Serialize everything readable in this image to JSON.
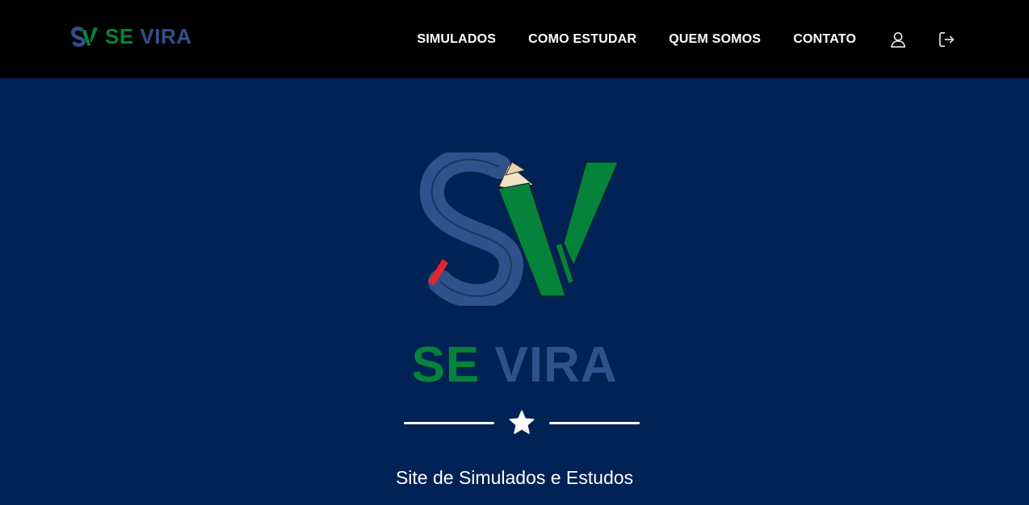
{
  "navbar": {
    "brand": {
      "se": "SE",
      "vira": "VIRA"
    },
    "links": [
      {
        "label": "SIMULADOS"
      },
      {
        "label": "COMO ESTUDAR"
      },
      {
        "label": "QUEM SOMOS"
      },
      {
        "label": "CONTATO"
      }
    ],
    "icons": {
      "account": "user-icon",
      "logout": "logout-icon"
    }
  },
  "hero": {
    "title_se": "SE",
    "title_vira": "VIRA",
    "divider_icon": "star-icon",
    "subtitle": "Site de Simulados e Estudos"
  },
  "colors": {
    "navbar_bg": "#000000",
    "hero_bg": "#012254",
    "brand_green": "#05833a",
    "brand_blue": "#30528b",
    "accent_red": "#e0262e",
    "text_white": "#ffffff"
  }
}
